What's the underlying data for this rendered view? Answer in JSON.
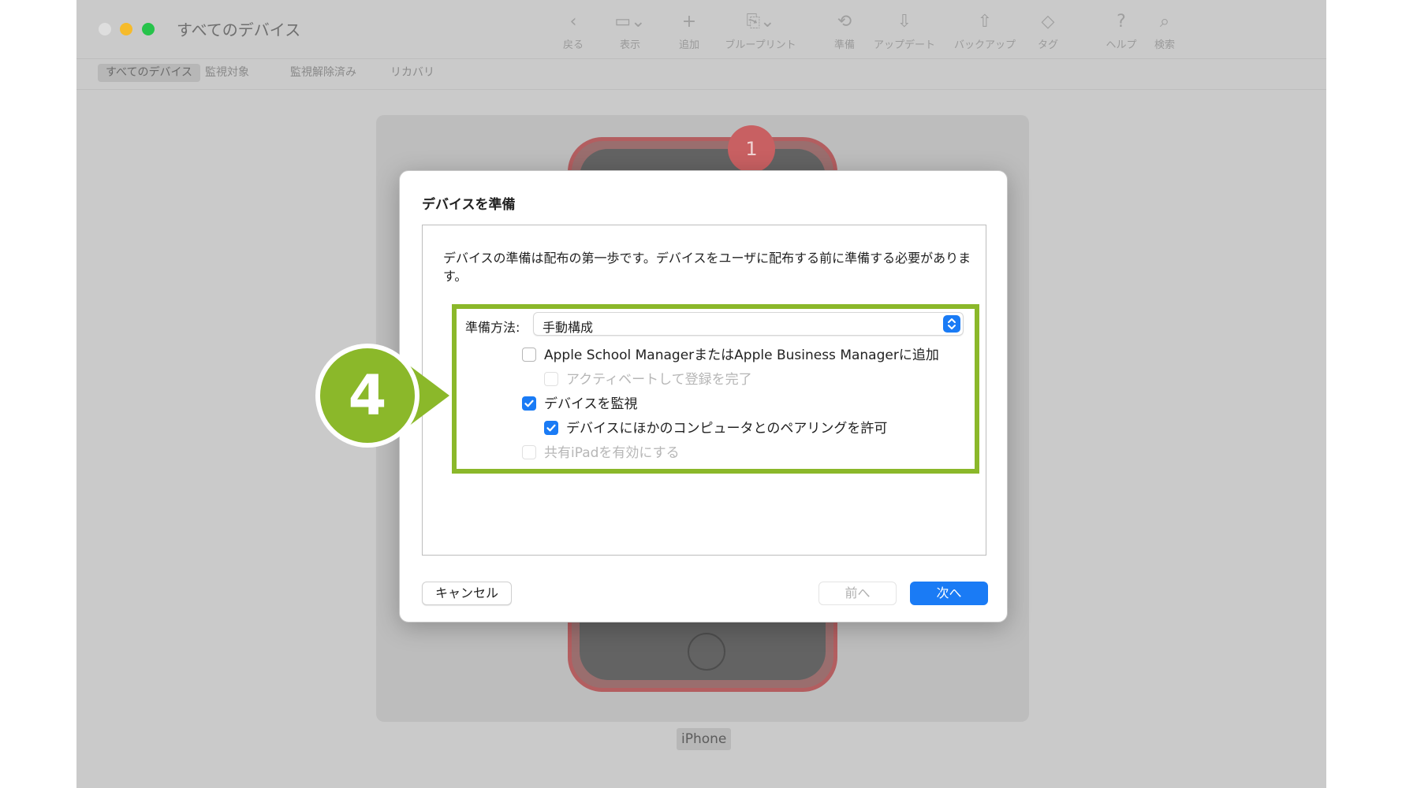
{
  "window": {
    "title": "すべてのデバイス"
  },
  "toolbar": [
    {
      "name": "back",
      "icon": "chevron-left-icon",
      "glyph": "‹",
      "label": "戻る"
    },
    {
      "name": "view",
      "icon": "view-icon",
      "glyph": "▭⌄",
      "label": "表示"
    },
    {
      "name": "add",
      "icon": "plus-icon",
      "glyph": "+",
      "label": "追加"
    },
    {
      "name": "blueprint",
      "icon": "blueprint-icon",
      "glyph": "⎘⌄",
      "label": "ブループリント"
    },
    {
      "name": "prepare",
      "icon": "prepare-icon",
      "glyph": "⟲",
      "label": "準備"
    },
    {
      "name": "update",
      "icon": "update-icon",
      "glyph": "⇩",
      "label": "アップデート"
    },
    {
      "name": "backup",
      "icon": "backup-icon",
      "glyph": "⇧",
      "label": "バックアップ"
    },
    {
      "name": "tag",
      "icon": "tag-icon",
      "glyph": "◇",
      "label": "タグ"
    },
    {
      "name": "help",
      "icon": "help-icon",
      "glyph": "?",
      "label": "ヘルプ"
    },
    {
      "name": "search",
      "icon": "search-icon",
      "glyph": "⌕",
      "label": "検索"
    }
  ],
  "scopes": [
    {
      "label": "すべてのデバイス",
      "selected": true
    },
    {
      "label": "監視対象",
      "selected": false
    },
    {
      "label": "監視解除済み",
      "selected": false
    },
    {
      "label": "リカバリ",
      "selected": false
    }
  ],
  "device": {
    "label": "iPhone"
  },
  "badges": {
    "red": "1",
    "callout": "4"
  },
  "dialog": {
    "title": "デバイスを準備",
    "description": "デバイスの準備は配布の第一歩です。デバイスをユーザに配布する前に準備する必要があります。",
    "method_label": "準備方法:",
    "method_value": "手動構成",
    "options": [
      {
        "label": "Apple School ManagerまたはApple Business Managerに追加",
        "checked": false,
        "disabled": false
      },
      {
        "label": "アクティベートして登録を完了",
        "checked": false,
        "disabled": true
      },
      {
        "label": "デバイスを監視",
        "checked": true,
        "disabled": false
      },
      {
        "label": "デバイスにほかのコンピュータとのペアリングを許可",
        "checked": true,
        "disabled": false
      },
      {
        "label": "共有iPadを有効にする",
        "checked": false,
        "disabled": true
      }
    ],
    "buttons": {
      "cancel": "キャンセル",
      "prev": "前へ",
      "next": "次へ"
    }
  },
  "colors": {
    "accent": "#1a7bf5",
    "highlight_green": "#8bb82a",
    "badge_red": "#c86062"
  }
}
